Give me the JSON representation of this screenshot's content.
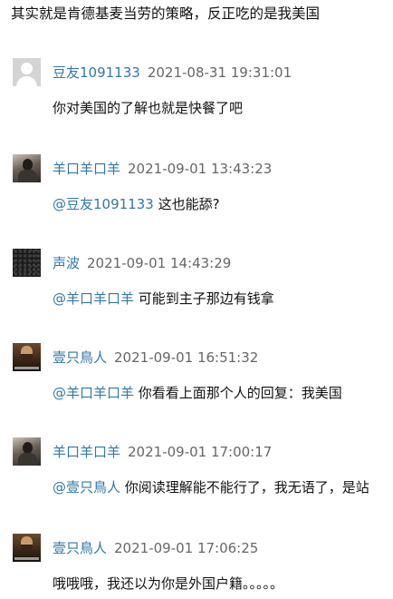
{
  "intro_text": "其实就是肯德基麦当劳的策略，反正吃的是我美国",
  "comments": [
    {
      "author": "豆友1091133",
      "time": "2021-08-31 19:31:01",
      "mention": "",
      "text": "你对美国的了解也就是快餐了吧",
      "avatar_icon": "default-user-avatar"
    },
    {
      "author": "羊口羊口羊",
      "time": "2021-09-01 13:43:23",
      "mention": "@豆友1091133",
      "text": "这也能舔?",
      "avatar_icon": "person-photo-avatar"
    },
    {
      "author": "声波",
      "time": "2021-09-01 14:43:29",
      "mention": "@羊口羊口羊",
      "text": "可能到主子那边有钱拿",
      "avatar_icon": "dark-texture-avatar"
    },
    {
      "author": "壹只鳥人",
      "time": "2021-09-01 16:51:32",
      "mention": "@羊口羊口羊",
      "text": "你看看上面那个人的回复：我美国",
      "avatar_icon": "bearded-man-avatar"
    },
    {
      "author": "羊口羊口羊",
      "time": "2021-09-01 17:00:17",
      "mention": "@壹只鳥人",
      "text": "你阅读理解能不能行了，我无语了，是站",
      "avatar_icon": "person-photo-avatar"
    },
    {
      "author": "壹只鳥人",
      "time": "2021-09-01 17:06:25",
      "mention": "",
      "text": "哦哦哦，我还以为你是外国户籍。。。。。",
      "avatar_icon": "bearded-man-avatar"
    }
  ],
  "colors": {
    "link": "#3377aa",
    "time": "#666666",
    "text": "#111111"
  }
}
